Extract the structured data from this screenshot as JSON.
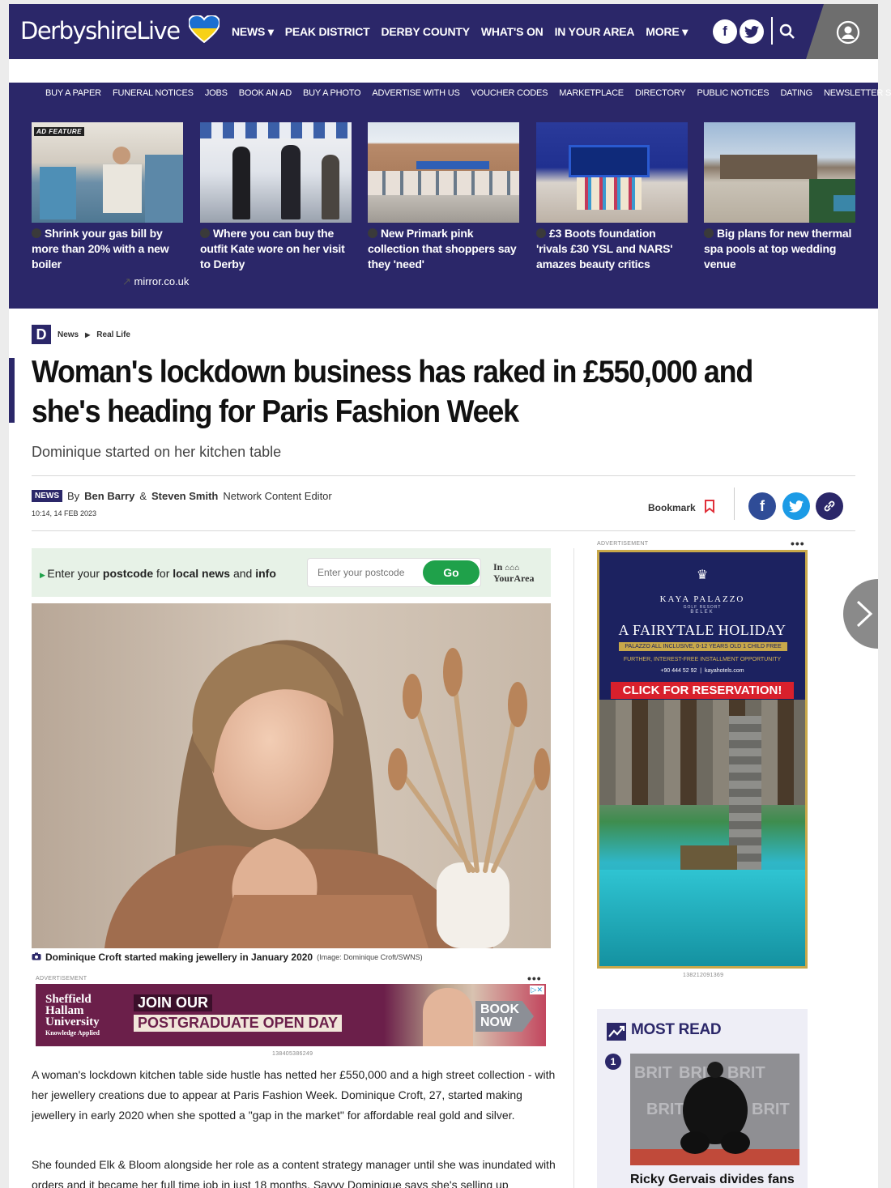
{
  "site": {
    "logo_main": "Derbyshire",
    "logo_accent": "Live"
  },
  "nav": {
    "items": [
      "NEWS",
      "PEAK DISTRICT",
      "DERBY COUNTY",
      "WHAT'S ON",
      "IN YOUR AREA",
      "MORE"
    ]
  },
  "subnav": {
    "links": [
      "BUY A PAPER",
      "FUNERAL NOTICES",
      "JOBS",
      "BOOK AN AD",
      "BUY A PHOTO",
      "ADVERTISE WITH US",
      "VOUCHER CODES",
      "MARKETPLACE",
      "DIRECTORY",
      "PUBLIC NOTICES",
      "DATING",
      "NEWSLETTER SIGNUP"
    ]
  },
  "promos": [
    {
      "title": "Shrink your gas bill by more than 20% with a new boiler",
      "badge": "AD FEATURE",
      "source": "mirror.co.uk"
    },
    {
      "title": "Where you can buy the outfit Kate wore on her visit to Derby"
    },
    {
      "title": "New Primark pink collection that shoppers say they 'need'"
    },
    {
      "title": "£3 Boots foundation 'rivals £30 YSL and NARS' amazes beauty critics"
    },
    {
      "title": "Big plans for new thermal spa pools at top wedding venue"
    }
  ],
  "breadcrumb": {
    "logo": "D",
    "items": [
      "News",
      "Real Life"
    ]
  },
  "article": {
    "headline": "Woman's lockdown business has raked in £550,000 and she's heading for Paris Fashion Week",
    "standfirst": "Dominique started on her kitchen table",
    "badge": "NEWS",
    "by": "By",
    "author1": "Ben Barry",
    "amp": "&",
    "author2": "Steven Smith",
    "role": "Network Content Editor",
    "date": "10:14, 14 FEB 2023",
    "bookmark": "Bookmark",
    "caption": "Dominique Croft started making jewellery in January 2020",
    "caption_credit": "(Image: Dominique Croft/SWNS)",
    "para1": "A woman's lockdown kitchen table side hustle has netted her £550,000 and a high street collection - with her jewellery creations due to appear at Paris Fashion Week. Dominique Croft, 27, started making jewellery in early 2020 when she spotted a \"gap in the market\" for affordable real gold and silver.",
    "para2": "She founded Elk & Bloom alongside her role as a content strategy manager until she was inundated with orders and it became her full time job in just 18 months. Savvy Dominique says she's selling up"
  },
  "postcode": {
    "prefix": "Enter your",
    "b1": "postcode",
    "mid1": "for",
    "b2": "local news",
    "mid2": "and",
    "b3": "info",
    "placeholder": "Enter your postcode",
    "go": "Go",
    "brand_top": "In",
    "brand_bottom": "YourArea"
  },
  "ads": {
    "label": "ADVERTISEMENT",
    "dots": "•••",
    "banner_brand1": "Sheffield",
    "banner_brand2": "Hallam",
    "banner_brand3": "University",
    "banner_brand4": "Knowledge Applied",
    "banner_line1": "JOIN OUR",
    "banner_line2": "POSTGRADUATE OPEN DAY",
    "banner_cta1": "BOOK",
    "banner_cta2": "NOW",
    "banner_id": "138405386249",
    "side_brand": "KAYA PALAZZO",
    "side_sub": "GOLF RESORT",
    "side_loc": "BELEK",
    "side_title": "A FAIRYTALE HOLIDAY",
    "side_offer": "PALAZZO ALL INCLUSIVE, 0-12 YEARS OLD 1 CHILD FREE",
    "side_further": "FURTHER, INTEREST-FREE INSTALLMENT OPPORTUNITY",
    "side_phone": "+90 444 52 92",
    "side_site": "kayahotels.com",
    "side_cta": "CLICK FOR RESERVATION!",
    "side_id": "138212091369"
  },
  "most_read": {
    "title": "MOST READ",
    "num": "1",
    "story": "Ricky Gervais divides fans"
  },
  "colors": {
    "brand": "#2b2769",
    "go": "#1fa14a",
    "facebook": "#2f4c97",
    "twitter": "#1c9be6"
  }
}
